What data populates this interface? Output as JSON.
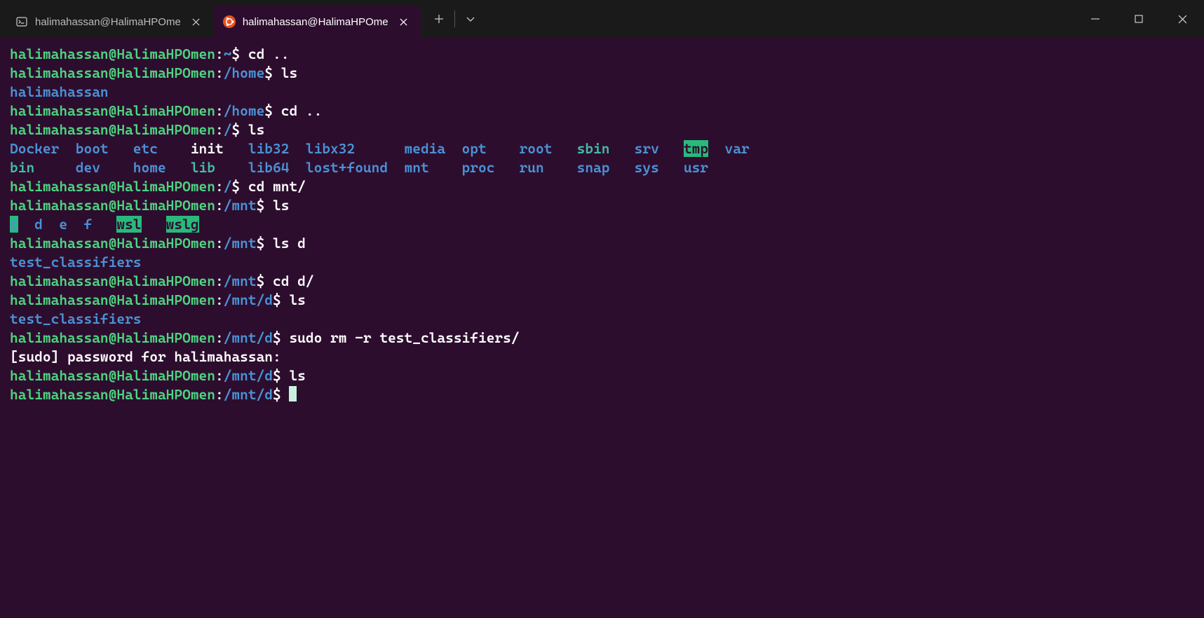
{
  "titlebar": {
    "tabs": [
      {
        "title": "halimahassan@HalimaHPOme",
        "active": false
      },
      {
        "title": "halimahassan@HalimaHPOme",
        "active": true
      }
    ]
  },
  "prompt": {
    "user": "halimahassan",
    "host": "HalimaHPOmen",
    "at": "@",
    "sep": ":",
    "sigil": "$"
  },
  "paths": {
    "home": "~",
    "home_dir": "/home",
    "root": "/",
    "mnt": "/mnt",
    "mnt_d": "/mnt/d"
  },
  "commands": {
    "cd_up": " cd ..",
    "ls": " ls",
    "cd_mnt": " cd mnt/",
    "ls_d": " ls d",
    "cd_d": " cd d/",
    "sudo_rm": " sudo rm -r test_classifiers/"
  },
  "outputs": {
    "home_ls": "halimahassan",
    "root_ls_row1": [
      {
        "t": "Docker",
        "cls": "dir"
      },
      {
        "t": "boot",
        "cls": "dir"
      },
      {
        "t": "etc",
        "cls": "dir"
      },
      {
        "t": "init",
        "cls": "plain"
      },
      {
        "t": "lib32",
        "cls": "dir"
      },
      {
        "t": "libx32",
        "cls": "dir"
      },
      {
        "t": "media",
        "cls": "dir"
      },
      {
        "t": "opt",
        "cls": "dir"
      },
      {
        "t": "root",
        "cls": "dir"
      },
      {
        "t": "sbin",
        "cls": "link"
      },
      {
        "t": "srv",
        "cls": "dir"
      },
      {
        "t": "tmp",
        "cls": "dir-sticky"
      },
      {
        "t": "var",
        "cls": "dir"
      }
    ],
    "root_ls_row2": [
      {
        "t": "bin",
        "cls": "link"
      },
      {
        "t": "dev",
        "cls": "dir"
      },
      {
        "t": "home",
        "cls": "dir"
      },
      {
        "t": "lib",
        "cls": "link"
      },
      {
        "t": "lib64",
        "cls": "dir"
      },
      {
        "t": "lost+found",
        "cls": "dir"
      },
      {
        "t": "mnt",
        "cls": "dir"
      },
      {
        "t": "proc",
        "cls": "dir"
      },
      {
        "t": "run",
        "cls": "dir"
      },
      {
        "t": "snap",
        "cls": "dir"
      },
      {
        "t": "sys",
        "cls": "dir"
      },
      {
        "t": "usr",
        "cls": "dir"
      }
    ],
    "root_cols": [
      0,
      8,
      15,
      22,
      29,
      36,
      48,
      55,
      62,
      69,
      76,
      82,
      87
    ],
    "mnt_ls": [
      {
        "t": "c",
        "cls": "link-sticky"
      },
      {
        "t": "d",
        "cls": "dir"
      },
      {
        "t": "e",
        "cls": "dir"
      },
      {
        "t": "f",
        "cls": "dir"
      },
      {
        "t": "wsl",
        "cls": "dir-sticky"
      },
      {
        "t": "wslg",
        "cls": "dir-sticky"
      }
    ],
    "mnt_cols": [
      0,
      3,
      6,
      9,
      13,
      19
    ],
    "test_classifiers": "test_classifiers",
    "sudo_prompt": "[sudo] password for halimahassan:"
  }
}
